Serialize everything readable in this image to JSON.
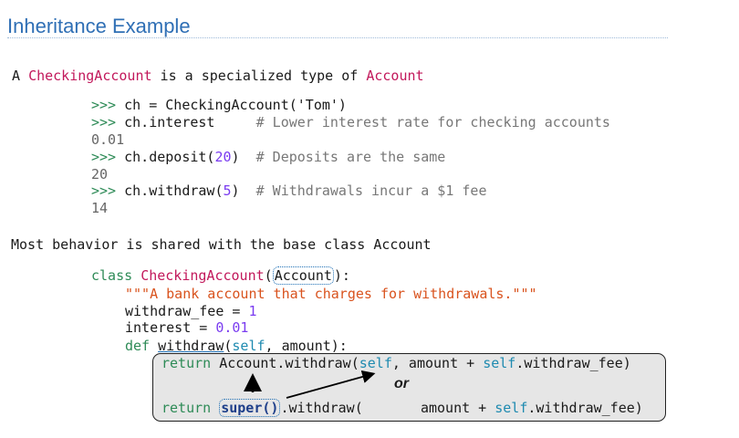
{
  "slide": {
    "title": "Inheritance Example"
  },
  "intro": {
    "p1": "A ",
    "c1": "CheckingAccount",
    "p2": " is a specialized type of ",
    "c2": "Account"
  },
  "session": [
    {
      "prompt": ">>>",
      "code": " ch = CheckingAccount('Tom')"
    },
    {
      "prompt": ">>>",
      "code": " ch.interest     ",
      "comment": "# Lower interest rate for checking accounts"
    },
    {
      "output": "0.01"
    },
    {
      "prompt": ">>>",
      "code_a": " ch.deposit(",
      "num": "20",
      "code_b": ")  ",
      "comment": "# Deposits are the same"
    },
    {
      "output": "20"
    },
    {
      "prompt": ">>>",
      "code_a": " ch.withdraw(",
      "num": "5",
      "code_b": ")  ",
      "comment": "# Withdrawals incur a $1 fee"
    },
    {
      "output": "14"
    }
  ],
  "shared": {
    "text": "Most behavior is shared with the base class Account"
  },
  "code": {
    "kw_class": "class",
    "class_name": "CheckingAccount",
    "base": "Account",
    "docstring": "\"\"\"A bank account that charges for withdrawals.\"\"\"",
    "fee_name": "withdraw_fee = ",
    "fee_val": "1",
    "interest_name": "interest = ",
    "interest_val": "0.01",
    "kw_def": "def",
    "method": "withdraw",
    "self": "self",
    "params_rest": ", amount):",
    "kw_return": "return",
    "ret1_a": " Account.withdraw(",
    "ret1_b": ", amount + ",
    "ret1_c": ".withdraw_fee)",
    "or": "or",
    "super_call": "super()",
    "ret2_a": ".withdraw(       amount + ",
    "ret2_c": ".withdraw_fee)"
  },
  "colors": {
    "title": "#2f6fb5",
    "keyword": "#2e8b57",
    "class_name": "#c2185b",
    "string": "#d9531e",
    "number": "#7a3cf0",
    "self": "#1e8ab0"
  }
}
